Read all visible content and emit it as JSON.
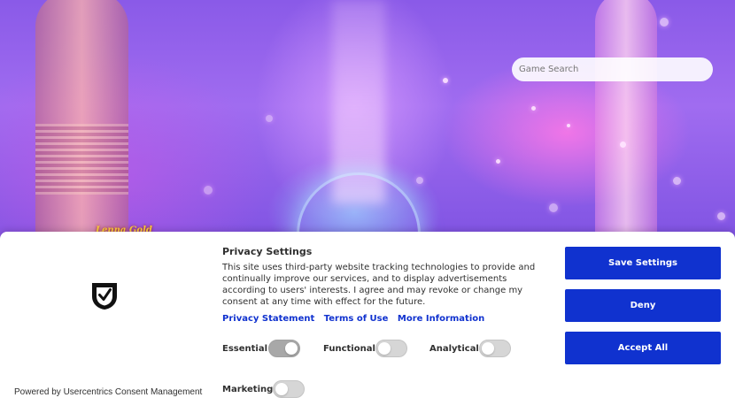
{
  "search": {
    "placeholder": "Game Search"
  },
  "hero": {
    "logo_text": "Lenna Gold"
  },
  "consent": {
    "title": "Privacy Settings",
    "description": "This site uses third-party website tracking technologies to provide and continually improve our services, and to display advertisements according to users' interests. I agree and may revoke or change my consent at any time with effect for the future.",
    "links": {
      "privacy_statement": "Privacy Statement",
      "terms_of_use": "Terms of Use",
      "more_information": "More Information"
    },
    "toggles": {
      "essential": {
        "label": "Essential",
        "on": true
      },
      "functional": {
        "label": "Functional",
        "on": false
      },
      "analytical": {
        "label": "Analytical",
        "on": false
      },
      "marketing": {
        "label": "Marketing",
        "on": false
      }
    },
    "buttons": {
      "save_settings": "Save Settings",
      "deny": "Deny",
      "accept_all": "Accept All"
    },
    "powered_by": "Powered by Usercentrics Consent Management",
    "accent_color": "#1032cf"
  }
}
